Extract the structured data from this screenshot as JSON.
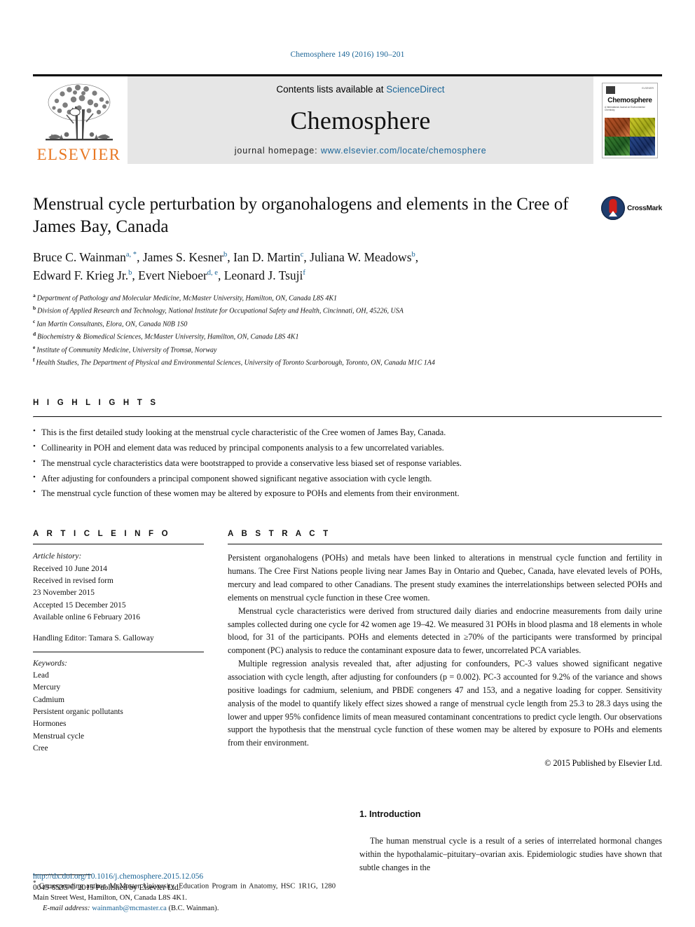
{
  "running_head": "Chemosphere 149 (2016) 190–201",
  "masthead": {
    "publisher_logo_label": "ELSEVIER",
    "contents_prefix": "Contents lists available at",
    "contents_link": "ScienceDirect",
    "journal_name": "Chemosphere",
    "homepage_prefix": "journal homepage:",
    "homepage_url": "www.elsevier.com/locate/chemosphere",
    "cover": {
      "title": "Chemosphere",
      "subtitle": "A International Journal on Environmental Chemistry",
      "corner_label": "ELSEVIER"
    }
  },
  "article": {
    "title": "Menstrual cycle perturbation by organohalogens and elements in the Cree of James Bay, Canada",
    "crossmark_label": "CrossMark",
    "authors_line_1": [
      {
        "name": "Bruce C. Wainman",
        "sup": "a, *"
      },
      {
        "name": "James S. Kesner",
        "sup": "b"
      },
      {
        "name": "Ian D. Martin",
        "sup": "c"
      },
      {
        "name": "Juliana W. Meadows",
        "sup": "b"
      }
    ],
    "authors_line_2": [
      {
        "name": "Edward F. Krieg Jr.",
        "sup": "b"
      },
      {
        "name": "Evert Nieboer",
        "sup": "d, e"
      },
      {
        "name": "Leonard J. Tsuji",
        "sup": "f"
      }
    ],
    "affiliations": [
      {
        "key": "a",
        "text": "Department of Pathology and Molecular Medicine, McMaster University, Hamilton, ON, Canada L8S 4K1"
      },
      {
        "key": "b",
        "text": "Division of Applied Research and Technology, National Institute for Occupational Safety and Health, Cincinnati, OH, 45226, USA"
      },
      {
        "key": "c",
        "text": "Ian Martin Consultants, Elora, ON, Canada N0B 1S0"
      },
      {
        "key": "d",
        "text": "Biochemistry & Biomedical Sciences, McMaster University, Hamilton, ON, Canada L8S 4K1"
      },
      {
        "key": "e",
        "text": "Institute of Community Medicine, University of Tromsø, Norway"
      },
      {
        "key": "f",
        "text": "Health Studies, The Department of Physical and Environmental Sciences, University of Toronto Scarborough, Toronto, ON, Canada M1C 1A4"
      }
    ]
  },
  "highlights": {
    "heading": "H I G H L I G H T S",
    "items": [
      "This is the first detailed study looking at the menstrual cycle characteristic of the Cree women of James Bay, Canada.",
      "Collinearity in POH and element data was reduced by principal components analysis to a few uncorrelated variables.",
      "The menstrual cycle characteristics data were bootstrapped to provide a conservative less biased set of response variables.",
      "After adjusting for confounders a principal component showed significant negative association with cycle length.",
      "The menstrual cycle function of these women may be altered by exposure to POHs and elements from their environment."
    ]
  },
  "article_info": {
    "heading": "A R T I C L E    I N F O",
    "history_label": "Article history:",
    "history": [
      "Received 10 June 2014",
      "Received in revised form",
      "23 November 2015",
      "Accepted 15 December 2015",
      "Available online 6 February 2016"
    ],
    "handling_editor": "Handling Editor: Tamara S. Galloway",
    "keywords_label": "Keywords:",
    "keywords": [
      "Lead",
      "Mercury",
      "Cadmium",
      "Persistent organic pollutants",
      "Hormones",
      "Menstrual cycle",
      "Cree"
    ]
  },
  "abstract": {
    "heading": "A B S T R A C T",
    "paragraphs": [
      "Persistent organohalogens (POHs) and metals have been linked to alterations in menstrual cycle function and fertility in humans. The Cree First Nations people living near James Bay in Ontario and Quebec, Canada, have elevated levels of POHs, mercury and lead compared to other Canadians. The present study examines the interrelationships between selected POHs and elements on menstrual cycle function in these Cree women.",
      "Menstrual cycle characteristics were derived from structured daily diaries and endocrine measurements from daily urine samples collected during one cycle for 42 women age 19–42. We measured 31 POHs in blood plasma and 18 elements in whole blood, for 31 of the participants. POHs and elements detected in ≥70% of the participants were transformed by principal component (PC) analysis to reduce the contaminant exposure data to fewer, uncorrelated PCA variables.",
      "Multiple regression analysis revealed that, after adjusting for confounders, PC-3 values showed significant negative association with cycle length, after adjusting for confounders (p = 0.002). PC-3 accounted for 9.2% of the variance and shows positive loadings for cadmium, selenium, and PBDE congeners 47 and 153, and a negative loading for copper. Sensitivity analysis of the model to quantify likely effect sizes showed a range of menstrual cycle length from 25.3 to 28.3 days using the lower and upper 95% confidence limits of mean measured contaminant concentrations to predict cycle length. Our observations support the hypothesis that the menstrual cycle function of these women may be altered by exposure to POHs and elements from their environment."
    ],
    "copyright": "© 2015 Published by Elsevier Ltd."
  },
  "corresponding": {
    "star": "*",
    "line1": "Corresponding author. McMaster University, Education Program in Anatomy, HSC 1R1G, 1280 Main Street West, Hamilton, ON, Canada L8S 4K1.",
    "email_label": "E-mail address:",
    "email": "wainmanb@mcmaster.ca",
    "email_owner": "(B.C. Wainman)."
  },
  "introduction": {
    "heading": "1.  Introduction",
    "paragraph": "The human menstrual cycle is a result of a series of interrelated hormonal changes within the hypothalamic–pituitary–ovarian axis. Epidemiologic studies have shown that subtle changes in the"
  },
  "page_footer": {
    "doi": "http://dx.doi.org/10.1016/j.chemosphere.2015.12.056",
    "issn": "0045-6535/© 2015 Published by Elsevier Ltd."
  },
  "colors": {
    "link": "#1a6496",
    "elsevier_orange": "#E87722",
    "masthead_bg": "#e6e6e6"
  }
}
